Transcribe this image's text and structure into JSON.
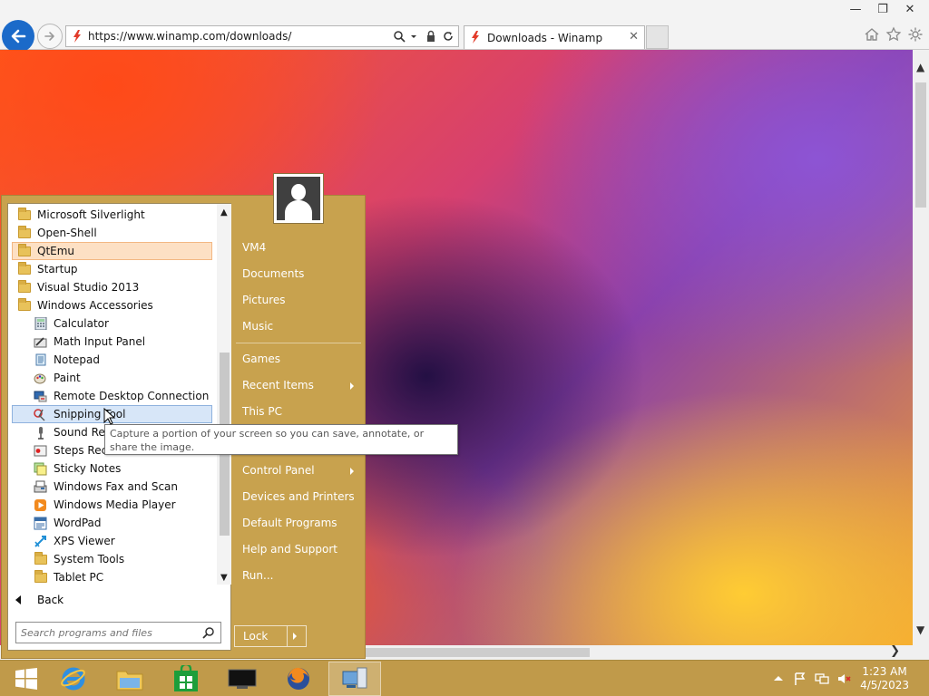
{
  "browser": {
    "url": "https://www.winamp.com/downloads/",
    "tab_title": "Downloads - Winamp",
    "tab_close": "✕",
    "window_controls": [
      "—",
      "❐",
      "✕"
    ]
  },
  "start_menu": {
    "programs": [
      {
        "label": "Microsoft Silverlight",
        "icon": "folder-icon",
        "indent": 0,
        "state": "normal"
      },
      {
        "label": "Open-Shell",
        "icon": "folder-icon",
        "indent": 0,
        "state": "normal"
      },
      {
        "label": "QtEmu",
        "icon": "folder-icon",
        "indent": 0,
        "state": "highlighted"
      },
      {
        "label": "Startup",
        "icon": "folder-icon",
        "indent": 0,
        "state": "normal"
      },
      {
        "label": "Visual Studio 2013",
        "icon": "folder-icon",
        "indent": 0,
        "state": "normal"
      },
      {
        "label": "Windows Accessories",
        "icon": "folder-icon",
        "indent": 0,
        "state": "normal"
      },
      {
        "label": "Calculator",
        "icon": "calculator-icon",
        "indent": 1,
        "state": "normal"
      },
      {
        "label": "Math Input Panel",
        "icon": "math-input-icon",
        "indent": 1,
        "state": "normal"
      },
      {
        "label": "Notepad",
        "icon": "notepad-icon",
        "indent": 1,
        "state": "normal"
      },
      {
        "label": "Paint",
        "icon": "paint-icon",
        "indent": 1,
        "state": "normal"
      },
      {
        "label": "Remote Desktop Connection",
        "icon": "remote-desktop-icon",
        "indent": 1,
        "state": "normal"
      },
      {
        "label": "Snipping Tool",
        "icon": "snipping-tool-icon",
        "indent": 1,
        "state": "hover"
      },
      {
        "label": "Sound Recorder",
        "icon": "microphone-icon",
        "indent": 1,
        "state": "normal"
      },
      {
        "label": "Steps Recorder",
        "icon": "steps-recorder-icon",
        "indent": 1,
        "state": "normal"
      },
      {
        "label": "Sticky Notes",
        "icon": "sticky-notes-icon",
        "indent": 1,
        "state": "normal"
      },
      {
        "label": "Windows Fax and Scan",
        "icon": "fax-icon",
        "indent": 1,
        "state": "normal"
      },
      {
        "label": "Windows Media Player",
        "icon": "media-player-icon",
        "indent": 1,
        "state": "normal"
      },
      {
        "label": "WordPad",
        "icon": "wordpad-icon",
        "indent": 1,
        "state": "normal"
      },
      {
        "label": "XPS Viewer",
        "icon": "xps-viewer-icon",
        "indent": 1,
        "state": "normal"
      },
      {
        "label": "System Tools",
        "icon": "folder-icon",
        "indent": 1,
        "state": "normal"
      },
      {
        "label": "Tablet PC",
        "icon": "folder-icon",
        "indent": 1,
        "state": "normal"
      }
    ],
    "back_label": "Back",
    "search_placeholder": "Search programs and files",
    "right_links": [
      {
        "label": "VM4",
        "submenu": false
      },
      {
        "label": "Documents",
        "submenu": false
      },
      {
        "label": "Pictures",
        "submenu": false
      },
      {
        "label": "Music",
        "submenu": false
      },
      {
        "label": "Games",
        "submenu": false
      },
      {
        "label": "Recent Items",
        "submenu": true
      },
      {
        "label": "This PC",
        "submenu": false
      },
      {
        "label": "Control Panel",
        "submenu": true
      },
      {
        "label": "Devices and Printers",
        "submenu": false
      },
      {
        "label": "Default Programs",
        "submenu": false
      },
      {
        "label": "Help and Support",
        "submenu": false
      },
      {
        "label": "Run...",
        "submenu": false
      }
    ],
    "lock_label": "Lock",
    "tooltip": "Capture a portion of your screen so you can save, annotate, or share the image."
  },
  "taskbar": {
    "items": [
      "start-button",
      "internet-explorer",
      "file-explorer",
      "store",
      "media-player",
      "firefox",
      "network-app"
    ],
    "active_item": "network-app",
    "clock_time": "1:23 AM",
    "clock_date": "4/5/2023"
  },
  "colors": {
    "start_menu_bg": "#c8a24e",
    "taskbar_bg": "#c09a4a",
    "ie_blue": "#1b6ac9",
    "winamp_red": "#e23b2a"
  }
}
